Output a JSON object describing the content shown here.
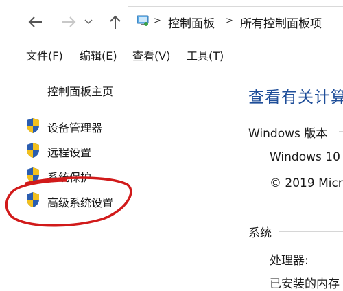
{
  "address_bar": {
    "breadcrumbs": [
      "控制面板",
      "所有控制面板项"
    ]
  },
  "menu": {
    "items": [
      "文件(F)",
      "编辑(E)",
      "查看(V)",
      "工具(T)"
    ]
  },
  "left_pane": {
    "home_link": "控制面板主页",
    "links": [
      "设备管理器",
      "远程设置",
      "系统保护",
      "高级系统设置"
    ]
  },
  "main": {
    "title": "查看有关计算",
    "windows_edition": {
      "heading": "Windows 版本",
      "edition": "Windows 10",
      "copyright": "© 2019 Micr"
    },
    "system": {
      "heading": "系统",
      "processor_label": "处理器:",
      "memory_label": "已安装的内存"
    }
  },
  "colors": {
    "title_blue": "#1f4e99",
    "annotation_red": "#d11a1a"
  },
  "icons": [
    "back-arrow-icon",
    "forward-arrow-icon",
    "up-arrow-icon",
    "control-panel-icon",
    "shield-icon"
  ]
}
